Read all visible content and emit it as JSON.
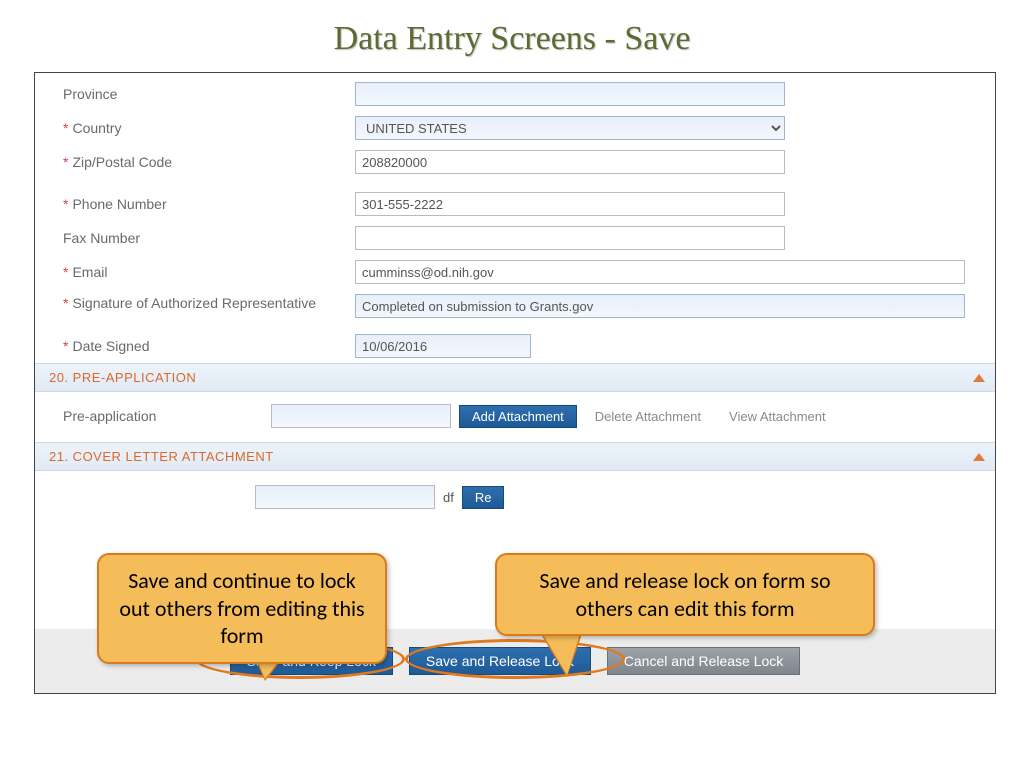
{
  "title": "Data Entry Screens - Save",
  "fields": {
    "province": {
      "label": "Province",
      "value": ""
    },
    "country": {
      "label": "Country",
      "value": "UNITED STATES",
      "required": true
    },
    "zip": {
      "label": "Zip/Postal Code",
      "value": "208820000",
      "required": true
    },
    "phone": {
      "label": "Phone Number",
      "value": "301-555-2222",
      "required": true
    },
    "fax": {
      "label": "Fax Number",
      "value": ""
    },
    "email": {
      "label": "Email",
      "value": "cumminss@od.nih.gov",
      "required": true
    },
    "signature": {
      "label": "Signature of Authorized Representative",
      "value": "Completed on submission to Grants.gov",
      "required": true
    },
    "date_signed": {
      "label": "Date Signed",
      "value": "10/06/2016",
      "required": true
    }
  },
  "sections": {
    "preapp": {
      "title": "20. PRE-APPLICATION",
      "label": "Pre-application"
    },
    "cover": {
      "title": "21. COVER LETTER ATTACHMENT"
    }
  },
  "buttons": {
    "add_attachment": "Add Attachment",
    "delete_attachment": "Delete Attachment",
    "view_attachment": "View Attachment",
    "save_keep": "Save and Keep Lock",
    "save_release": "Save and Release Lock",
    "cancel_release": "Cancel and Release Lock",
    "remove_short": "Re",
    "pdf_short": "df"
  },
  "callouts": {
    "left": "Save and continue to lock out others from editing this form",
    "right": "Save and release lock on form so others can edit this form"
  }
}
